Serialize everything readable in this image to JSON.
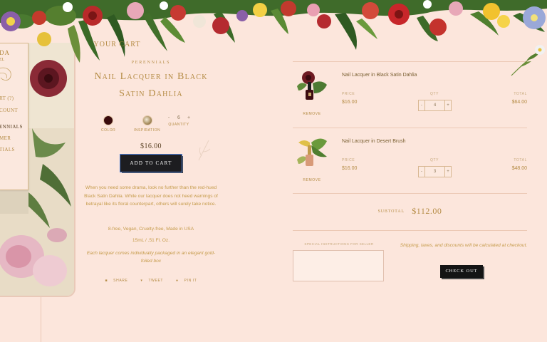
{
  "nav": {
    "logo_text": "DA",
    "logo_sub": "EL",
    "items": [
      {
        "label": "RT (?)"
      },
      {
        "label": "COUNT"
      },
      {
        "label": "ENNIALS"
      },
      {
        "label": "MER"
      },
      {
        "label": "TIALS"
      }
    ]
  },
  "product": {
    "collection": "PERENNIALS",
    "title": "Nail Lacquer in Black Satin Dahlia",
    "color_label": "COLOR",
    "inspiration_label": "INSPIRATION",
    "quantity_label": "QUANTITY",
    "qty_minus": "-",
    "qty_value": "6",
    "qty_plus": "+",
    "price": "$16.00",
    "add_to_cart": "ADD TO CART",
    "description": "When you need some drama, look no further than the red-hued Black Satin Dahlia.  While our lacquer does not heed warnings of betrayal like its floral counterpart, others will surely take notice.",
    "spec_free": "8-free, Vegan, Cruelty-free, Made in USA",
    "spec_volume": "15mL  /  .51 Fl. Oz.",
    "spec_packaging": "Each lacquer comes individually packaged in an elegant gold-foiled box",
    "share": {
      "share": "SHARE",
      "tweet": "TWEET",
      "pin": "PIN IT"
    },
    "colors": {
      "swatch": "#3a0b0d",
      "accent": "#b58c45",
      "button": "#1d1d20"
    }
  },
  "cart": {
    "heading": "YOUR CART",
    "price_label": "PRICE",
    "qty_label": "QTY",
    "total_label": "TOTAL",
    "remove_label": "REMOVE",
    "items": [
      {
        "name": "Nail Lacquer in Black Satin Dahlia",
        "price": "$16.00",
        "qty": "4",
        "total": "$64.00",
        "minus": "-",
        "plus": "+"
      },
      {
        "name": "Nail Lacquer in Desert Brush",
        "price": "$16.00",
        "qty": "3",
        "total": "$48.00",
        "minus": "-",
        "plus": "+"
      }
    ],
    "subtotal_label": "SUBTOTAL",
    "subtotal": "$112.00",
    "instructions_label": "SPECIAL INSTRUCTIONS FOR SELLER",
    "instructions_value": "",
    "shipping_note": "Shipping, taxes, and discounts will be calculated at checkout.",
    "checkout": "CHECK OUT"
  }
}
